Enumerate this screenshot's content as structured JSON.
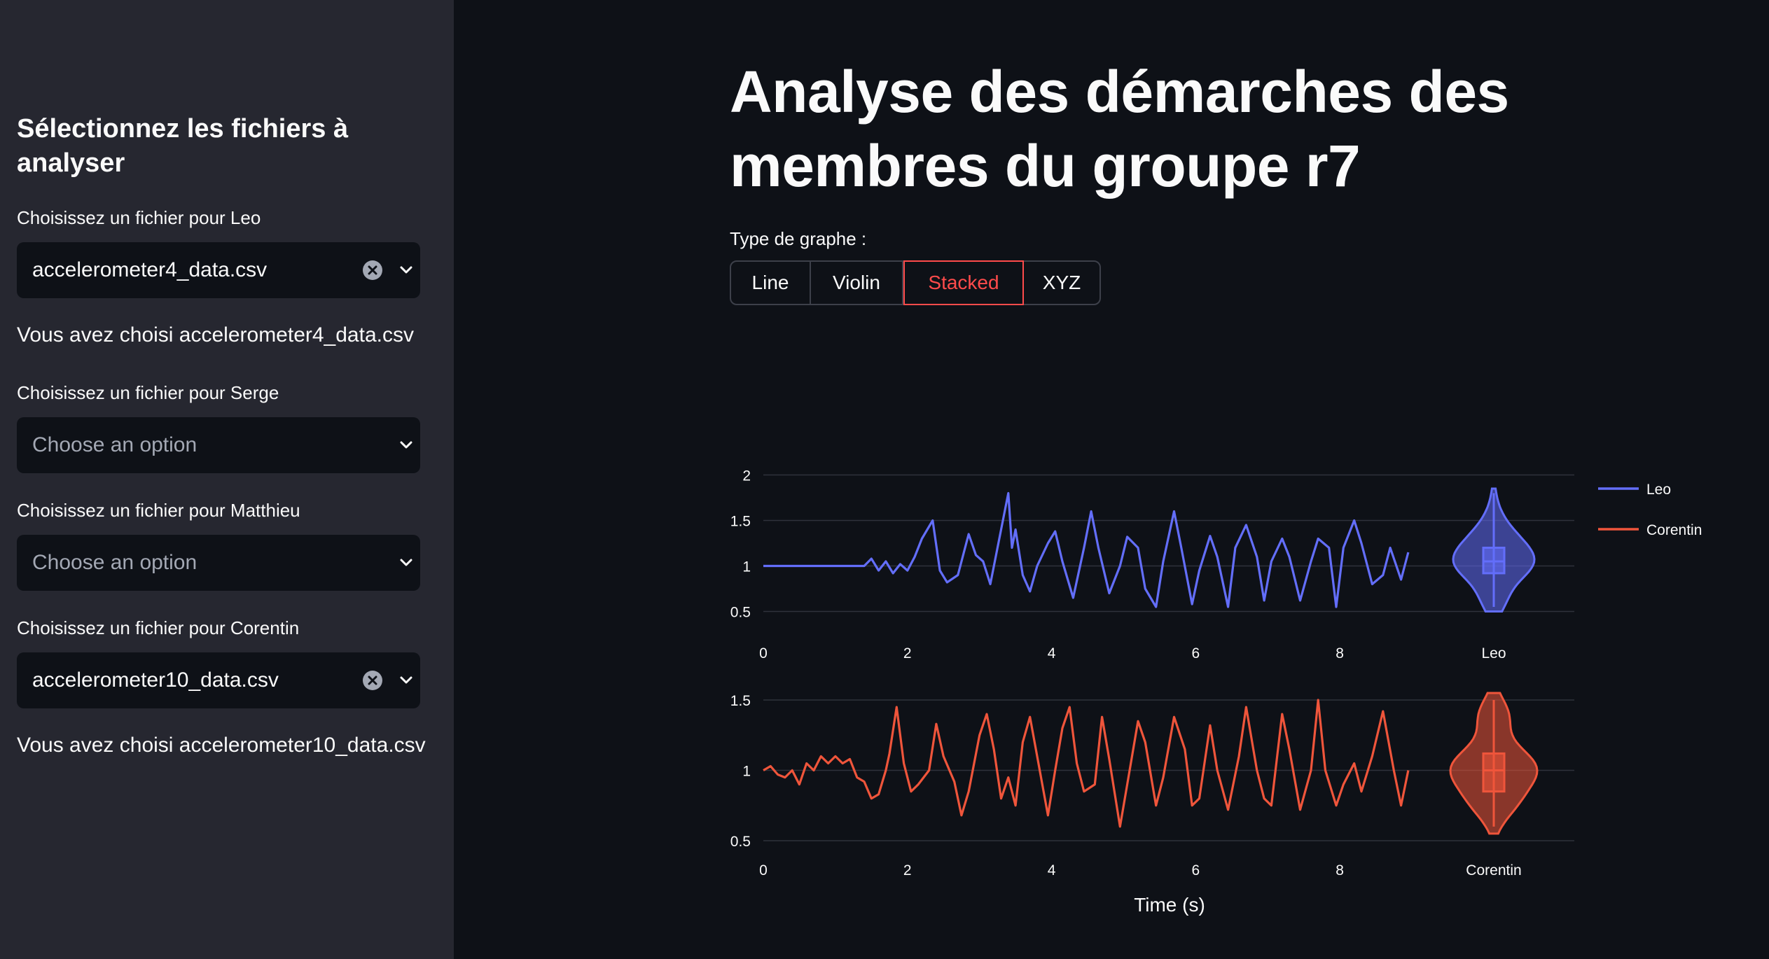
{
  "sidebar": {
    "title": "Sélectionnez les fichiers à analyser",
    "selectors": [
      {
        "label": "Choisissez un fichier pour Leo",
        "value": "accelerometer4_data.csv",
        "message": "Vous avez choisi accelerometer4_data.csv"
      },
      {
        "label": "Choisissez un fichier pour Serge",
        "placeholder": "Choose an option"
      },
      {
        "label": "Choisissez un fichier pour Matthieu",
        "placeholder": "Choose an option"
      },
      {
        "label": "Choisissez un fichier pour Corentin",
        "value": "accelerometer10_data.csv",
        "message": "Vous avez choisi accelerometer10_data.csv"
      }
    ]
  },
  "main": {
    "title": "Analyse des démarches des membres du groupe r7",
    "graph_type": {
      "label": "Type de graphe :",
      "options": [
        "Line",
        "Violin",
        "Stacked",
        "XYZ"
      ],
      "selected": "Stacked"
    }
  },
  "chart_data": {
    "type": "line",
    "xlabel": "Time (s)",
    "legend_placement": "top-right",
    "grid": true,
    "subplots": [
      {
        "series_name": "Leo",
        "color": "#636efa",
        "xlim": [
          0,
          9.0
        ],
        "yticks": [
          "0.5",
          "1",
          "1.5",
          "2"
        ],
        "ylim": [
          0.45,
          2.05
        ],
        "xticks": [
          "0",
          "2",
          "4",
          "6",
          "8"
        ],
        "violin_label": "Leo",
        "x": [
          0,
          0.3,
          0.6,
          0.9,
          1.2,
          1.4,
          1.5,
          1.6,
          1.7,
          1.8,
          1.9,
          2.0,
          2.1,
          2.2,
          2.35,
          2.45,
          2.55,
          2.7,
          2.85,
          2.95,
          3.05,
          3.15,
          3.3,
          3.4,
          3.45,
          3.5,
          3.6,
          3.7,
          3.8,
          3.95,
          4.05,
          4.15,
          4.3,
          4.45,
          4.55,
          4.65,
          4.8,
          4.95,
          5.05,
          5.2,
          5.3,
          5.45,
          5.55,
          5.7,
          5.8,
          5.95,
          6.05,
          6.2,
          6.3,
          6.45,
          6.55,
          6.7,
          6.85,
          6.95,
          7.05,
          7.2,
          7.3,
          7.45,
          7.6,
          7.7,
          7.85,
          7.95,
          8.05,
          8.2,
          8.3,
          8.45,
          8.6,
          8.7,
          8.85,
          8.95
        ],
        "y": [
          1.0,
          1.0,
          1.0,
          1.0,
          1.0,
          1.0,
          1.08,
          0.95,
          1.05,
          0.92,
          1.02,
          0.95,
          1.1,
          1.3,
          1.5,
          0.95,
          0.82,
          0.9,
          1.35,
          1.12,
          1.05,
          0.8,
          1.4,
          1.8,
          1.2,
          1.4,
          0.9,
          0.72,
          1.0,
          1.25,
          1.38,
          1.05,
          0.65,
          1.2,
          1.6,
          1.2,
          0.7,
          1.0,
          1.32,
          1.2,
          0.75,
          0.55,
          1.05,
          1.6,
          1.2,
          0.58,
          0.95,
          1.33,
          1.1,
          0.55,
          1.2,
          1.45,
          1.1,
          0.62,
          1.05,
          1.3,
          1.1,
          0.62,
          1.05,
          1.3,
          1.2,
          0.55,
          1.2,
          1.5,
          1.25,
          0.8,
          0.9,
          1.2,
          0.85,
          1.15
        ]
      },
      {
        "series_name": "Corentin",
        "color": "#ef553b",
        "xlim": [
          0,
          9.0
        ],
        "yticks": [
          "0.5",
          "1",
          "1.5"
        ],
        "ylim": [
          0.48,
          1.55
        ],
        "xticks": [
          "0",
          "2",
          "4",
          "6",
          "8"
        ],
        "violin_label": "Corentin",
        "x": [
          0,
          0.1,
          0.2,
          0.3,
          0.4,
          0.5,
          0.6,
          0.7,
          0.8,
          0.9,
          1.0,
          1.1,
          1.2,
          1.3,
          1.4,
          1.5,
          1.6,
          1.7,
          1.75,
          1.85,
          1.95,
          2.05,
          2.15,
          2.3,
          2.4,
          2.5,
          2.65,
          2.75,
          2.85,
          3.0,
          3.1,
          3.2,
          3.3,
          3.4,
          3.5,
          3.6,
          3.7,
          3.8,
          3.95,
          4.05,
          4.15,
          4.25,
          4.35,
          4.45,
          4.6,
          4.7,
          4.8,
          4.95,
          5.05,
          5.2,
          5.3,
          5.45,
          5.55,
          5.7,
          5.85,
          5.95,
          6.05,
          6.2,
          6.3,
          6.45,
          6.6,
          6.7,
          6.85,
          6.95,
          7.05,
          7.2,
          7.3,
          7.45,
          7.6,
          7.7,
          7.8,
          7.95,
          8.05,
          8.2,
          8.3,
          8.45,
          8.6,
          8.75,
          8.85,
          8.95
        ],
        "y": [
          1.0,
          1.03,
          0.97,
          0.95,
          1.0,
          0.9,
          1.05,
          1.0,
          1.1,
          1.05,
          1.1,
          1.05,
          1.08,
          0.95,
          0.92,
          0.8,
          0.83,
          1.0,
          1.12,
          1.45,
          1.05,
          0.85,
          0.9,
          1.0,
          1.33,
          1.1,
          0.92,
          0.68,
          0.85,
          1.25,
          1.4,
          1.15,
          0.8,
          0.95,
          0.75,
          1.2,
          1.38,
          1.1,
          0.68,
          1.0,
          1.3,
          1.45,
          1.05,
          0.85,
          0.9,
          1.38,
          1.08,
          0.6,
          0.9,
          1.35,
          1.2,
          0.75,
          0.95,
          1.38,
          1.15,
          0.75,
          0.8,
          1.32,
          1.0,
          0.72,
          1.1,
          1.45,
          1.0,
          0.8,
          0.75,
          1.4,
          1.15,
          0.72,
          1.0,
          1.5,
          1.0,
          0.75,
          0.9,
          1.05,
          0.85,
          1.1,
          1.42,
          1.0,
          0.75,
          1.0
        ]
      }
    ]
  }
}
